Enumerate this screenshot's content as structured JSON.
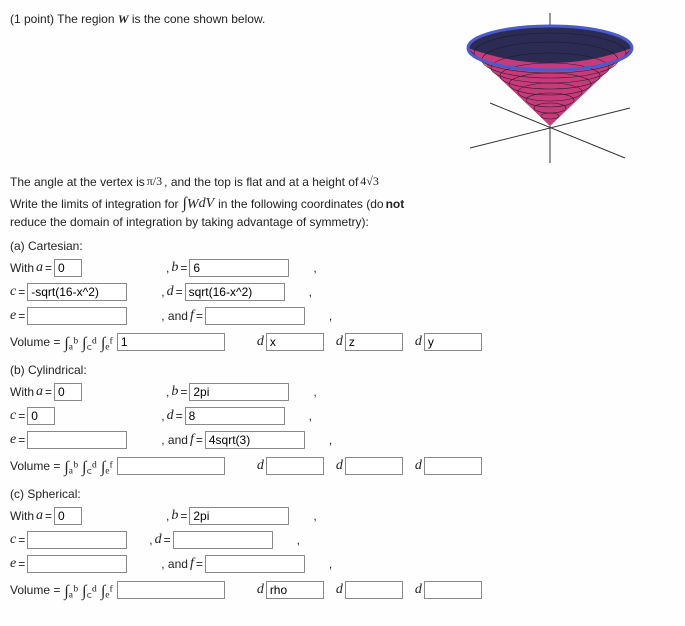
{
  "points": "(1 point)",
  "intro1": "The region ",
  "region_sym": "W",
  "intro2": " is the cone shown below.",
  "angle_pre": "The angle at the vertex is ",
  "angle_val": "π/3",
  "angle_post": ", and the top is flat and at a height of ",
  "height_val": "4√3",
  "write_pre": "Write the limits of integration for ",
  "write_int": "∫",
  "write_W": "W",
  "write_dV": " dV",
  "write_post": " in the following coordinates (do ",
  "write_not": "not",
  "write_post2": " reduce the domain of integration by taking advantage of symmetry):",
  "a_lbl": "a",
  "b_lbl": "b",
  "c_lbl": "c",
  "d_lbl": "d",
  "e_lbl": "e",
  "f_lbl": "f",
  "with": "With ",
  "and": ", and ",
  "eq_sym": " =",
  "comma": ",",
  "volume": "Volume = ",
  "triple_int": "∫ₐᵇ ∫꜀ᵈ ∫ₑᶠ",
  "dlet": "d",
  "cart": {
    "title": "(a) Cartesian:",
    "a": "0",
    "b": "6",
    "c": "-sqrt(16-x^2)",
    "d": "sqrt(16-x^2)",
    "e": "",
    "f": "",
    "v": "1",
    "d1": "x",
    "d2": "z",
    "d3": "y"
  },
  "cyl": {
    "title": "(b) Cylindrical:",
    "a": "0",
    "b": "2pi",
    "c": "0",
    "d": "8",
    "e": "",
    "f": "4sqrt(3)",
    "v": "",
    "d1": "",
    "d2": "",
    "d3": ""
  },
  "sph": {
    "title": "(c) Spherical:",
    "a": "0",
    "b": "2pi",
    "c": "",
    "d": "",
    "e": "",
    "f": "",
    "v": "",
    "d1": "rho",
    "d2": "",
    "d3": ""
  },
  "chart_data": {
    "type": "diagram",
    "description": "3D inverted cone with vertex at origin, opening upward, flat top",
    "vertex_half_angle": "π/6",
    "top_height": "4√3",
    "axes": [
      "x",
      "y",
      "z"
    ],
    "colors": {
      "top_rim": "#3a4a9a",
      "body": "#d03a7a",
      "stripes": "#222"
    }
  }
}
